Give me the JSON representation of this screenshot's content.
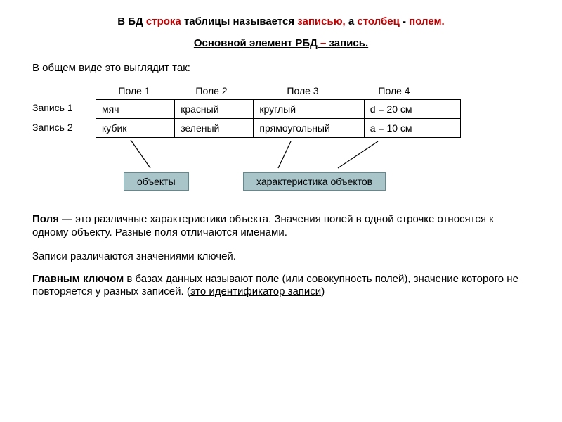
{
  "title": {
    "p1": "В БД ",
    "p2": "строка ",
    "p3": "таблицы называется ",
    "p4": "записью, ",
    "p5": "а ",
    "p6": "столбец ",
    "p7": "- ",
    "p8": "полем."
  },
  "sub": {
    "p1": "Основной элемент РБД ",
    "p2": "– ",
    "p3": "запись."
  },
  "intro": "В общем виде это выглядит так:",
  "cols": {
    "c1": "Поле 1",
    "c2": "Поле 2",
    "c3": "Поле 3",
    "c4": "Поле 4"
  },
  "rows": {
    "r1": "Запись 1",
    "r2": "Запись 2"
  },
  "data": {
    "r1c1": "мяч",
    "r1c2": "красный",
    "r1c3": "круглый",
    "r1c4": "d = 20 см",
    "r2c1": "кубик",
    "r2c2": "зеленый",
    "r2c3": "прямоугольный",
    "r2c4": "a = 10 см"
  },
  "labels": {
    "box1": "объекты",
    "box2": "характеристика объектов"
  },
  "para1": {
    "term": "Поля ",
    "rest1": "— это различные характеристики объекта. Значения полей в одной строчке относятся к одному объекту. Разные поля отличаются именами."
  },
  "para2": "Записи различаются значениями ключей.",
  "para3": {
    "term": "Главным ключом",
    "rest": " в базах данных называют поле (или совокупность полей), значение которого не повторяется у разных записей. (",
    "ul": "это идентификатор записи",
    "tail": ")"
  }
}
